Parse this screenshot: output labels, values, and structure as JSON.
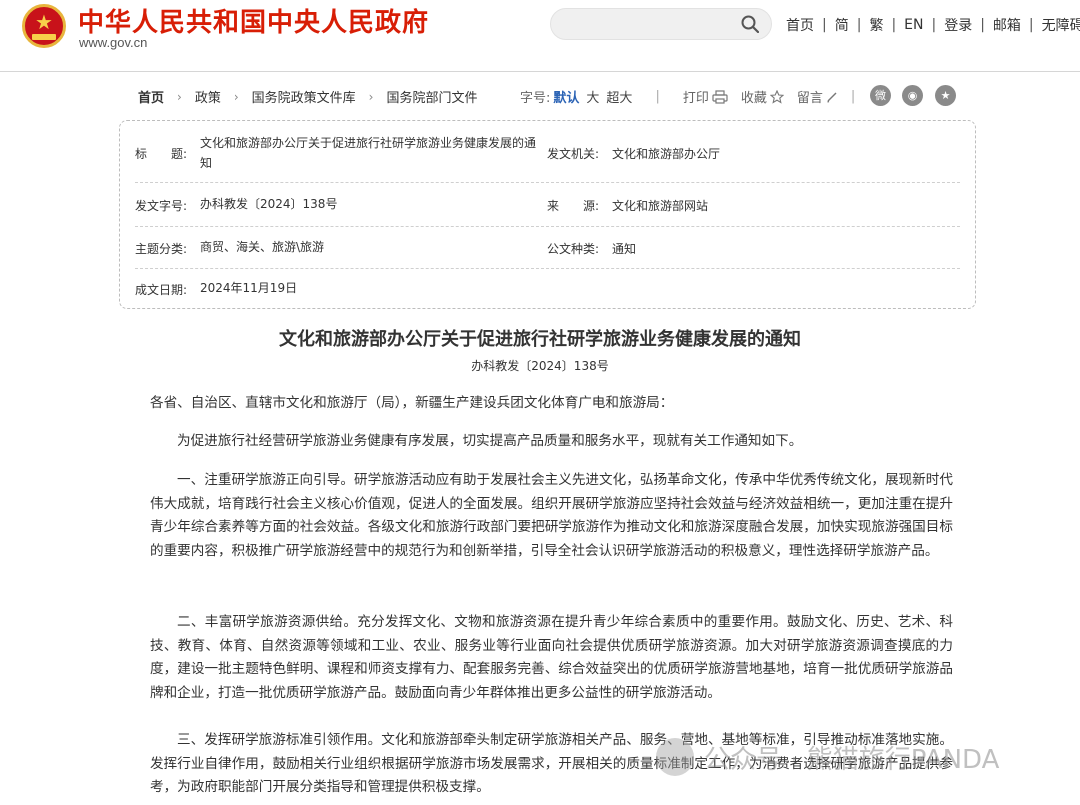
{
  "header": {
    "site_title": "中华人民共和国中央人民政府",
    "site_url": "www.gov.cn",
    "nav": [
      "首页",
      "简",
      "繁",
      "EN",
      "登录",
      "邮箱",
      "无障碍"
    ]
  },
  "breadcrumb": [
    "首页",
    "政策",
    "国务院政策文件库",
    "国务院部门文件"
  ],
  "toolbar": {
    "font_label": "字号:",
    "font_default": "默认",
    "font_large": "大",
    "font_xlarge": "超大",
    "print": "打印",
    "favorite": "收藏",
    "comment": "留言"
  },
  "info": {
    "title_label": "标　　题:",
    "title_value": "文化和旅游部办公厅关于促进旅行社研学旅游业务健康发展的通知",
    "issuer_label": "发文机关:",
    "issuer_value": "文化和旅游部办公厅",
    "docno_label": "发文字号:",
    "docno_value": "办科教发〔2024〕138号",
    "source_label": "来　　源:",
    "source_value": "文化和旅游部网站",
    "topic_label": "主题分类:",
    "topic_value": "商贸、海关、旅游\\旅游",
    "type_label": "公文种类:",
    "type_value": "通知",
    "date_label": "成文日期:",
    "date_value": "2024年11月19日"
  },
  "article": {
    "title": "文化和旅游部办公厅关于促进旅行社研学旅游业务健康发展的通知",
    "doc_no": "办科教发〔2024〕138号",
    "salutation": "各省、自治区、直辖市文化和旅游厅（局），新疆生产建设兵团文化体育广电和旅游局：",
    "paragraphs": [
      "为促进旅行社经营研学旅游业务健康有序发展，切实提高产品质量和服务水平，现就有关工作通知如下。",
      "一、注重研学旅游正向引导。研学旅游活动应有助于发展社会主义先进文化，弘扬革命文化，传承中华优秀传统文化，展现新时代伟大成就，培育践行社会主义核心价值观，促进人的全面发展。组织开展研学旅游应坚持社会效益与经济效益相统一，更加注重在提升青少年综合素养等方面的社会效益。各级文化和旅游行政部门要把研学旅游作为推动文化和旅游深度融合发展，加快实现旅游强国目标的重要内容，积极推广研学旅游经营中的规范行为和创新举措，引导全社会认识研学旅游活动的积极意义，理性选择研学旅游产品。",
      "二、丰富研学旅游资源供给。充分发挥文化、文物和旅游资源在提升青少年综合素质中的重要作用。鼓励文化、历史、艺术、科技、教育、体育、自然资源等领域和工业、农业、服务业等行业面向社会提供优质研学旅游资源。加大对研学旅游资源调查摸底的力度，建设一批主题特色鲜明、课程和师资支撑有力、配套服务完善、综合效益突出的优质研学旅游营地基地，培育一批优质研学旅游品牌和企业，打造一批优质研学旅游产品。鼓励面向青少年群体推出更多公益性的研学旅游活动。",
      "三、发挥研学旅游标准引领作用。文化和旅游部牵头制定研学旅游相关产品、服务、营地、基地等标准，引导推动标准落地实施。发挥行业自律作用，鼓励相关行业组织根据研学旅游市场发展需求，开展相关的质量标准制定工作，为消费者选择研学旅游产品提供参考，为政府职能部门开展分类指导和管理提供积极支撑。"
    ]
  },
  "watermark": "公众号 · 熊猫旅行PANDA"
}
